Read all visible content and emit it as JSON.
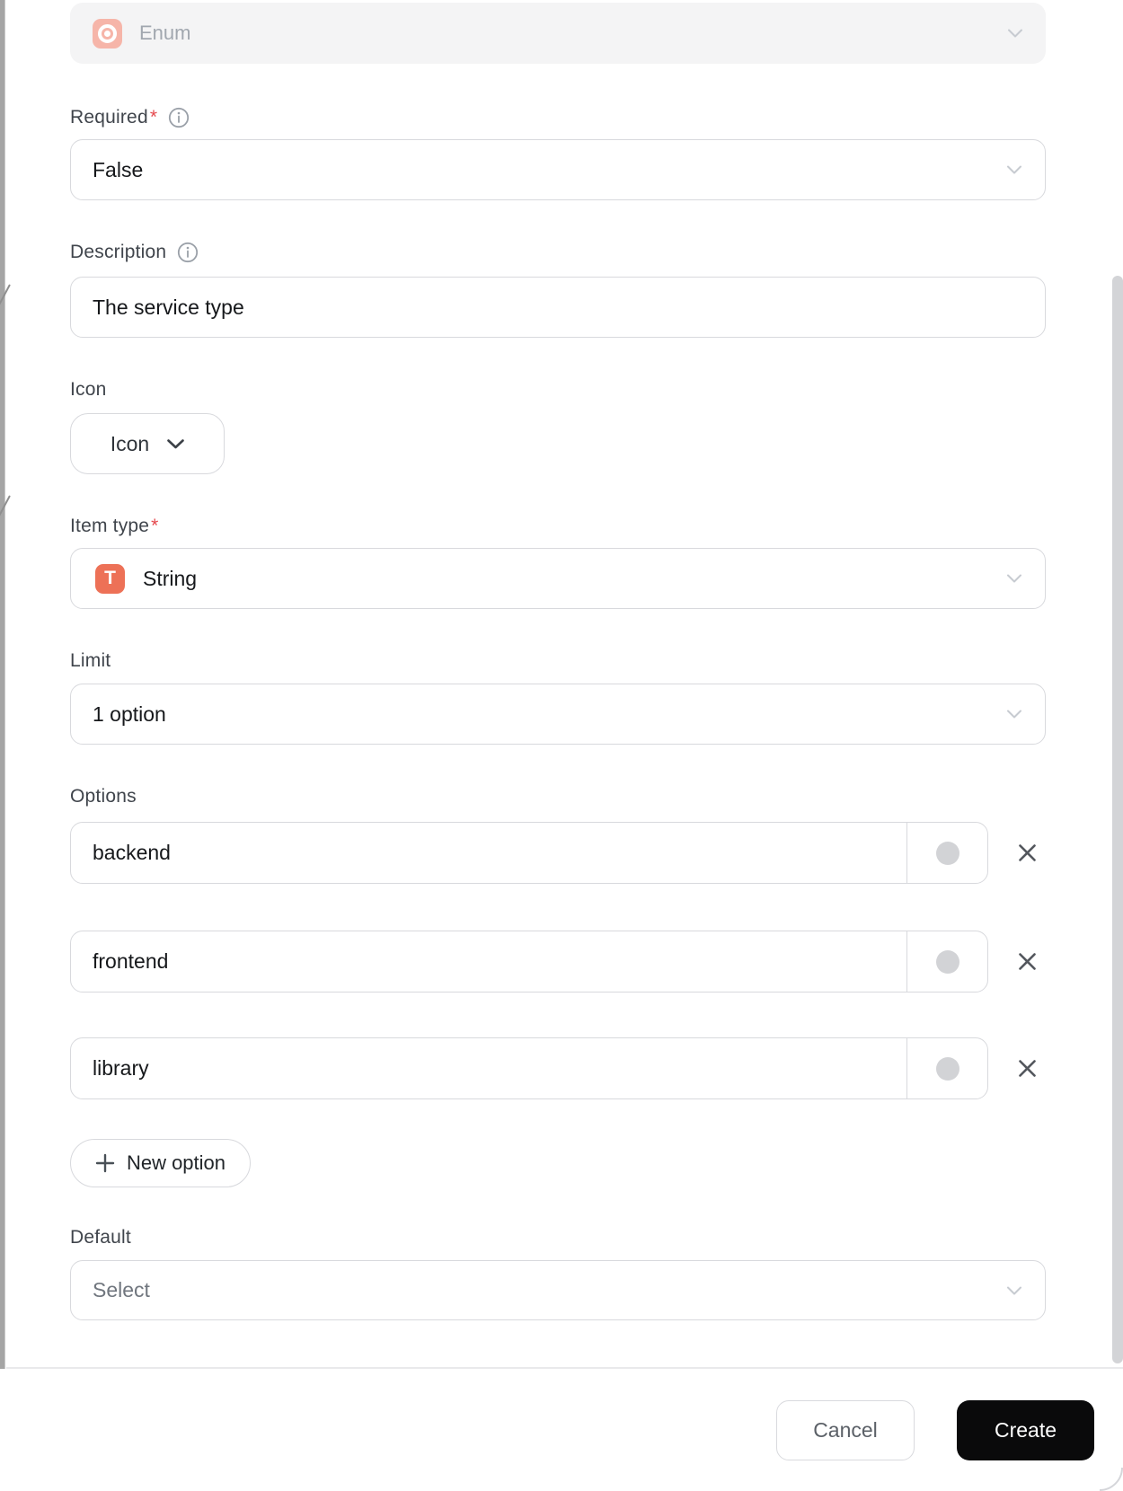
{
  "type_select": {
    "value": "Enum",
    "icon": "enum-icon"
  },
  "fields": {
    "required": {
      "label": "Required",
      "required_mark": "*",
      "value": "False"
    },
    "description": {
      "label": "Description",
      "value": "The service type"
    },
    "icon": {
      "label": "Icon",
      "button_label": "Icon"
    },
    "item_type": {
      "label": "Item type",
      "required_mark": "*",
      "value": "String",
      "value_icon": "T"
    },
    "limit": {
      "label": "Limit",
      "value": "1 option"
    },
    "options": {
      "label": "Options",
      "items": [
        "backend",
        "frontend",
        "library"
      ]
    },
    "new_option_label": "New option",
    "default": {
      "label": "Default",
      "placeholder": "Select"
    }
  },
  "footer": {
    "cancel_label": "Cancel",
    "create_label": "Create"
  },
  "colors": {
    "enum_icon_bg": "#f6b5a9",
    "string_badge_bg": "#ed7157",
    "required_star": "#e5484d",
    "create_button_bg": "#0a0a0b",
    "option_swatch": "#d2d3d6"
  }
}
